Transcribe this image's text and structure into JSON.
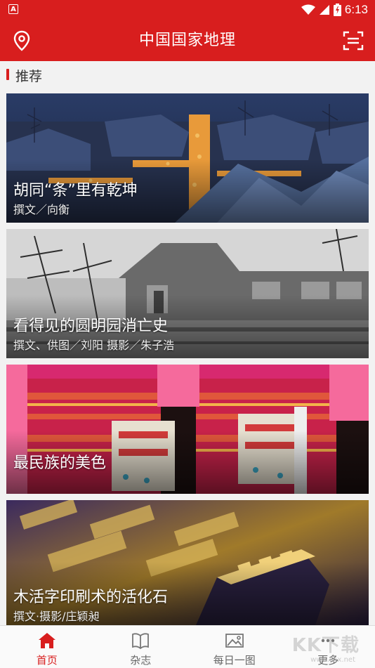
{
  "status": {
    "time": "6:13",
    "notification_icon": "A"
  },
  "app_bar": {
    "title": "中国国家地理",
    "location_icon": "location-pin-icon",
    "scan_icon": "scan-icon"
  },
  "section": {
    "title": "推荐"
  },
  "cards": [
    {
      "title": "胡同“条”里有乾坤",
      "author": "撰文／向衡"
    },
    {
      "title": "看得见的圆明园消亡史",
      "author": "撰文、供图／刘阳  摄影／朱子浩"
    },
    {
      "title": "最民族的美色",
      "author": ""
    },
    {
      "title": "木活字印刷术的活化石",
      "author": "撰文·摄影/庄颖昶"
    }
  ],
  "bottom_nav": {
    "items": [
      {
        "label": "首页",
        "icon": "home-icon",
        "active": true
      },
      {
        "label": "杂志",
        "icon": "book-icon",
        "active": false
      },
      {
        "label": "每日一图",
        "icon": "image-icon",
        "active": false
      },
      {
        "label": "更多",
        "icon": "more-icon",
        "active": false
      }
    ]
  },
  "watermark": {
    "text": "KK下载",
    "sub": "www.kkx.net"
  },
  "colors": {
    "brand_red": "#d81e1e",
    "nav_active": "#d81e1e",
    "nav_inactive": "#666666"
  }
}
